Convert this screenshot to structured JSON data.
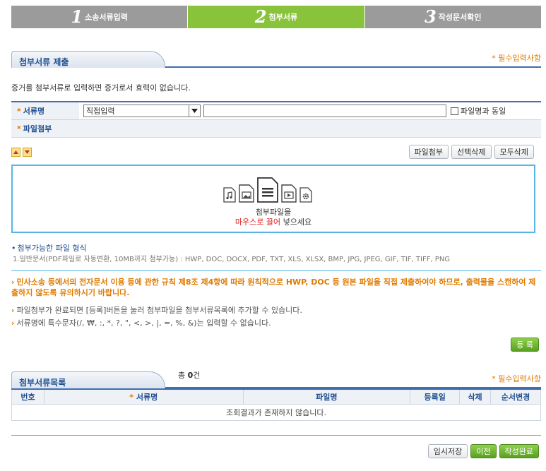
{
  "steps": [
    {
      "num": "1",
      "label": "소송서류입력"
    },
    {
      "num": "2",
      "label": "첨부서류"
    },
    {
      "num": "3",
      "label": "작성문서확인"
    }
  ],
  "colors": {
    "active_step": "#88c33b",
    "inactive_step": "#9b9b9b",
    "accent_blue": "#3f6fae",
    "required_orange": "#e07b00",
    "drop_border": "#5ab4e6"
  },
  "submit_section": {
    "tab_title": "첨부서류 제출",
    "required_note": "* 필수입력사항",
    "notice": "증거를 첨부서류로 입력하면 증거로서 효력이 없습니다.",
    "doc_name_label": "서류명",
    "doc_name_select": "직접입력",
    "same_as_filename": "파일명과 동일",
    "file_attach_label": "파일첨부"
  },
  "buttons": {
    "attach": "파일첨부",
    "delete_selected": "선택삭제",
    "delete_all": "모두삭제",
    "register": "등 록",
    "temp_save": "임시저장",
    "prev": "이전",
    "complete": "작성완료"
  },
  "icons": [
    "arrow-up-icon",
    "arrow-down-icon",
    "audio-file-icon",
    "image-file-icon",
    "document-file-icon",
    "video-file-icon",
    "settings-file-icon"
  ],
  "dropzone": {
    "line1": "첨부파일을",
    "line2_red": "마우스로 끌어",
    "line2_rest": " 넣으세요"
  },
  "allowed": {
    "title": "첨부가능한 파일 형식",
    "desc": "1.일반문서(PDF파일로 자동변환, 10MB까지 첨부가능) : HWP, DOC, DOCX, PDF, TXT, XLS, XLSX, BMP, JPG, JPEG, GIF, TIF, TIFF, PNG"
  },
  "warning": "민사소송 등에서의 전자문서 이용 등에 관한 규칙 제8조 제4항에 따라 원칙적으로 HWP, DOC 등 원본 파일을 직접 제출하여야 하므로, 출력물을 스캔하여 제출하지 않도록 유의하시기 바랍니다.",
  "notes": [
    "파일첨부가 완료되면 [등록]버튼을 눌러 첨부파일을 첨부서류목록에 추가할 수 있습니다.",
    "서류명에 특수문자(/, ₩, :, *, ?, \", <, >, |, =, %, &)는 입력할 수 없습니다."
  ],
  "list_section": {
    "tab_title": "첨부서류목록",
    "count_prefix": "총 ",
    "count_value": "0",
    "count_suffix": "건",
    "required_note": "* 필수입력사항",
    "columns": [
      "번호",
      "서류명",
      "파일명",
      "등록일",
      "삭제",
      "순서변경"
    ],
    "empty_message": "조회결과가 존재하지 않습니다."
  }
}
